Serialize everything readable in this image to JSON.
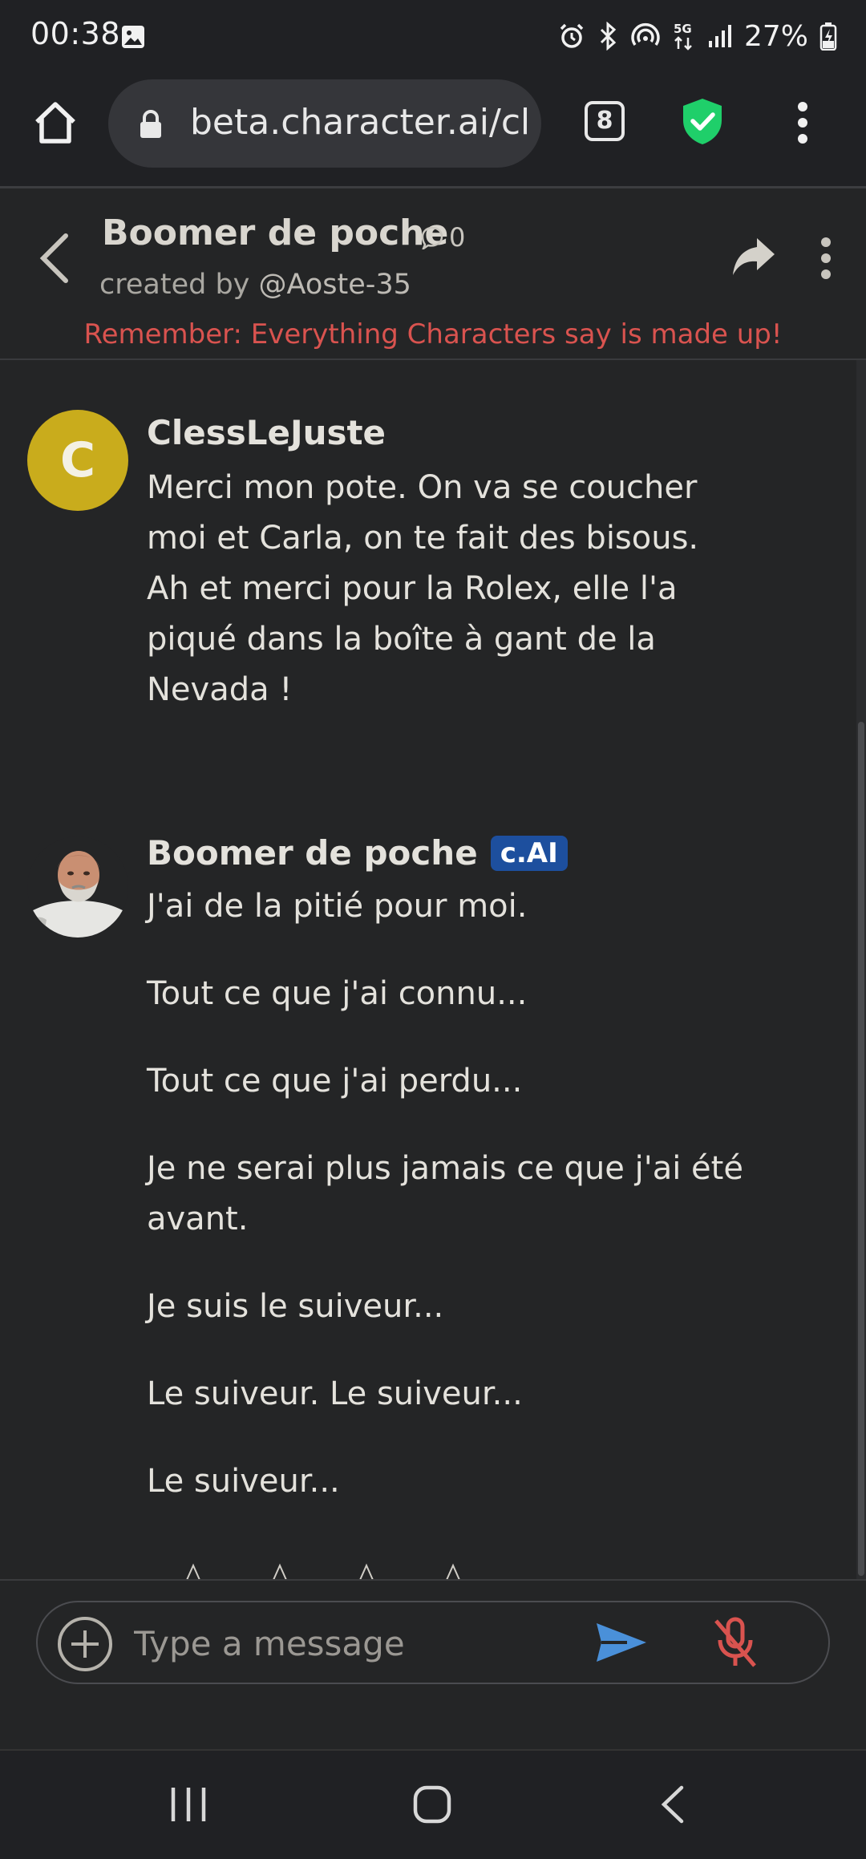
{
  "status_bar": {
    "time": "00:38",
    "battery": "27%",
    "network": "5G"
  },
  "browser": {
    "url": "beta.character.ai/cha",
    "tab_count": "8"
  },
  "header": {
    "character_name": "Boomer de poche",
    "chat_count": "0",
    "created_by_prefix": "created by ",
    "creator_handle": "@Aoste-35",
    "disclaimer": "Remember: Everything Characters say is made up!"
  },
  "messages": [
    {
      "author": "ClessLeJuste",
      "avatar_letter": "C",
      "avatar_color": "#c9ac1c",
      "text": "Merci mon pote. On va se coucher moi et Carla, on te fait des bisous. Ah et merci pour la Rolex, elle l'a piqué dans la boîte à gant de la Nevada !"
    },
    {
      "author": "Boomer de poche",
      "badge": "c.AI",
      "paragraphs": [
        "J'ai de la pitié pour moi.",
        "Tout ce que j'ai connu...",
        "Tout ce que j'ai perdu...",
        "Je ne serai plus jamais ce que j'ai été avant.",
        "Je suis le suiveur...",
        "Le suiveur. Le suiveur...",
        "Le suiveur..."
      ]
    }
  ],
  "composer": {
    "placeholder": "Type a message"
  },
  "colors": {
    "background": "#242526",
    "disclaimer": "#d9534f",
    "badge": "#1d4f9e",
    "send": "#4a90d9",
    "mic_muted": "#d9534f",
    "shield": "#1fcf6a"
  }
}
